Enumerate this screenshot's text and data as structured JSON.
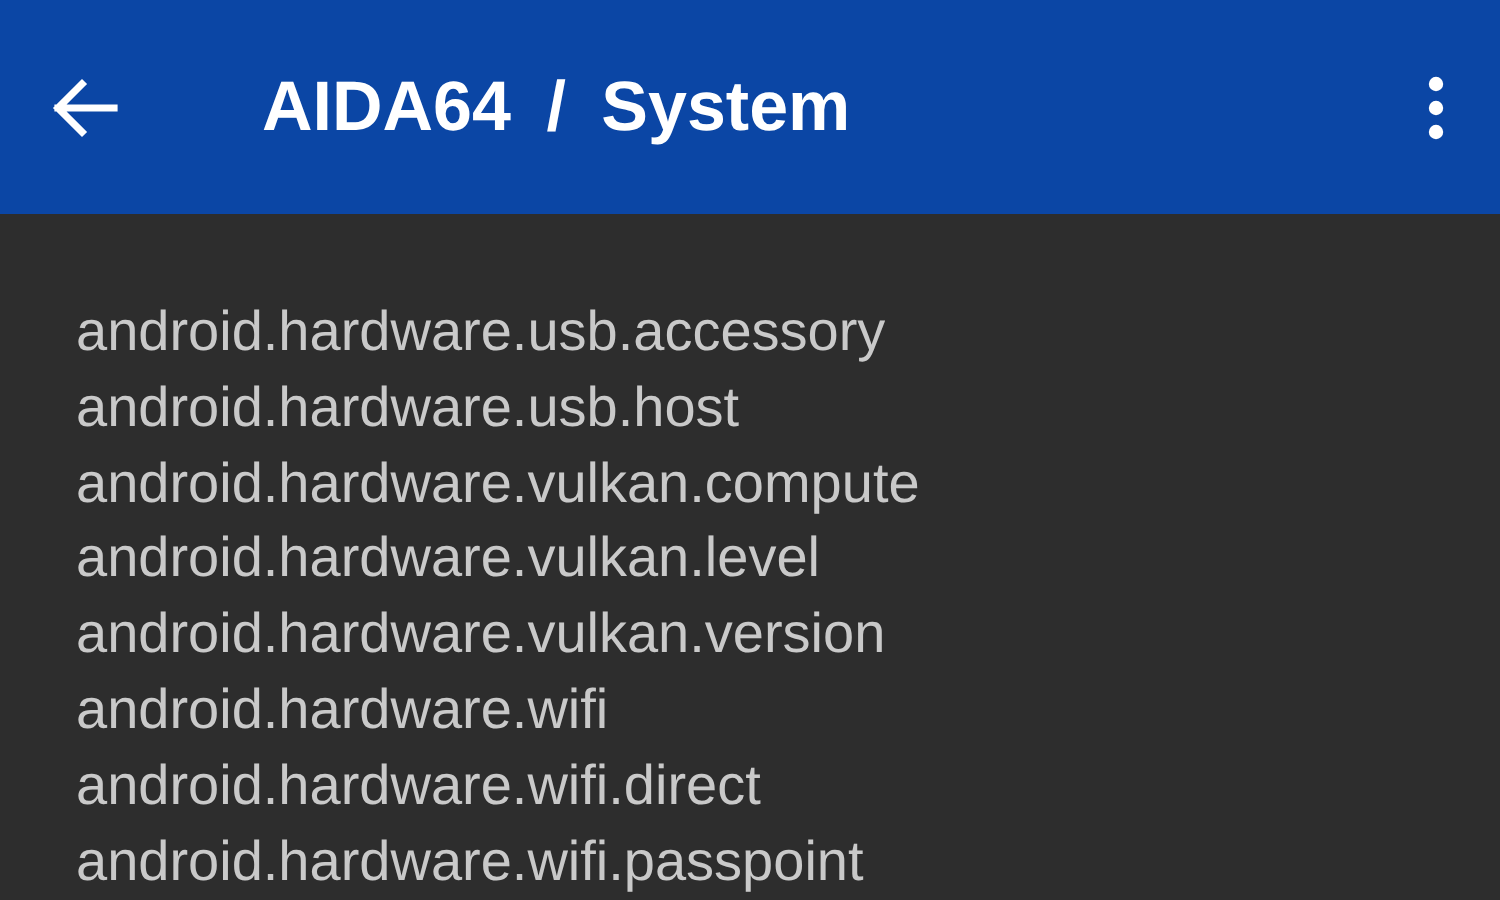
{
  "app_bar": {
    "title": "AIDA64 / System"
  },
  "features": [
    "android.hardware.usb.accessory",
    "android.hardware.usb.host",
    "android.hardware.vulkan.compute",
    "android.hardware.vulkan.level",
    "android.hardware.vulkan.version",
    "android.hardware.wifi",
    "android.hardware.wifi.direct",
    "android.hardware.wifi.passpoint"
  ]
}
